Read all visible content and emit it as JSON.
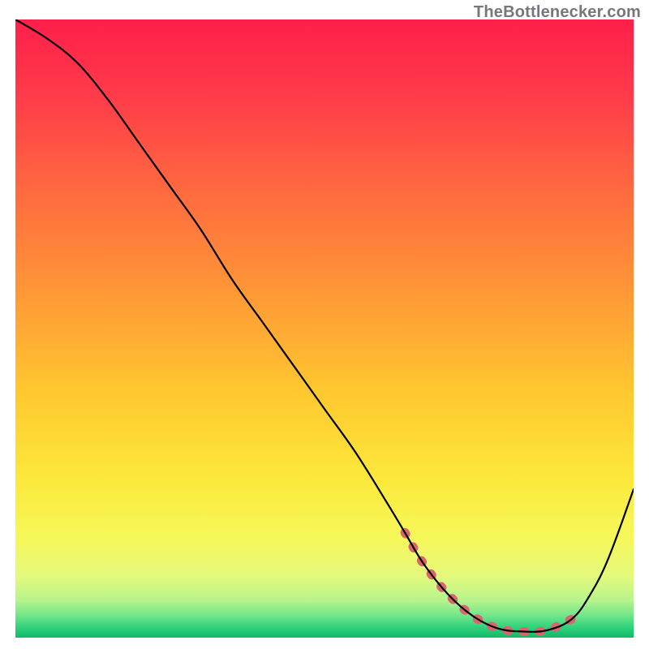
{
  "attribution": "TheBottlenecker.com",
  "chart_data": {
    "type": "line",
    "title": "",
    "xlabel": "",
    "ylabel": "",
    "xlim": [
      0,
      100
    ],
    "ylim": [
      0,
      100
    ],
    "series": [
      {
        "name": "curve",
        "x": [
          0,
          5,
          10,
          15,
          20,
          25,
          30,
          35,
          40,
          45,
          50,
          55,
          60,
          63,
          66,
          70,
          74,
          78,
          82,
          86,
          90,
          93,
          96,
          100
        ],
        "y": [
          100,
          97,
          93,
          87,
          80,
          73,
          66,
          58,
          51,
          44,
          37,
          30,
          22,
          17,
          12,
          7,
          3.5,
          1.5,
          1.0,
          1.2,
          3,
          7,
          13,
          24
        ],
        "color": "#000000",
        "width": 2.2
      },
      {
        "name": "highlight-band",
        "x": [
          63,
          66,
          70,
          74,
          78,
          82,
          86,
          90
        ],
        "y": [
          17,
          12,
          7,
          3.5,
          1.5,
          1.0,
          1.2,
          3
        ],
        "color": "#d9666e",
        "width": 11,
        "dashed": true
      }
    ],
    "background_gradient": {
      "stops": [
        {
          "offset": 0.0,
          "color": "#ff1f4b"
        },
        {
          "offset": 0.12,
          "color": "#ff3a4a"
        },
        {
          "offset": 0.28,
          "color": "#ff6a3f"
        },
        {
          "offset": 0.45,
          "color": "#ff9a36"
        },
        {
          "offset": 0.6,
          "color": "#ffc72f"
        },
        {
          "offset": 0.74,
          "color": "#fce83a"
        },
        {
          "offset": 0.84,
          "color": "#f6f85a"
        },
        {
          "offset": 0.9,
          "color": "#e4f97c"
        },
        {
          "offset": 0.94,
          "color": "#b6f48c"
        },
        {
          "offset": 0.965,
          "color": "#6fe58a"
        },
        {
          "offset": 0.985,
          "color": "#2bd07a"
        },
        {
          "offset": 1.0,
          "color": "#0fb968"
        }
      ]
    }
  }
}
